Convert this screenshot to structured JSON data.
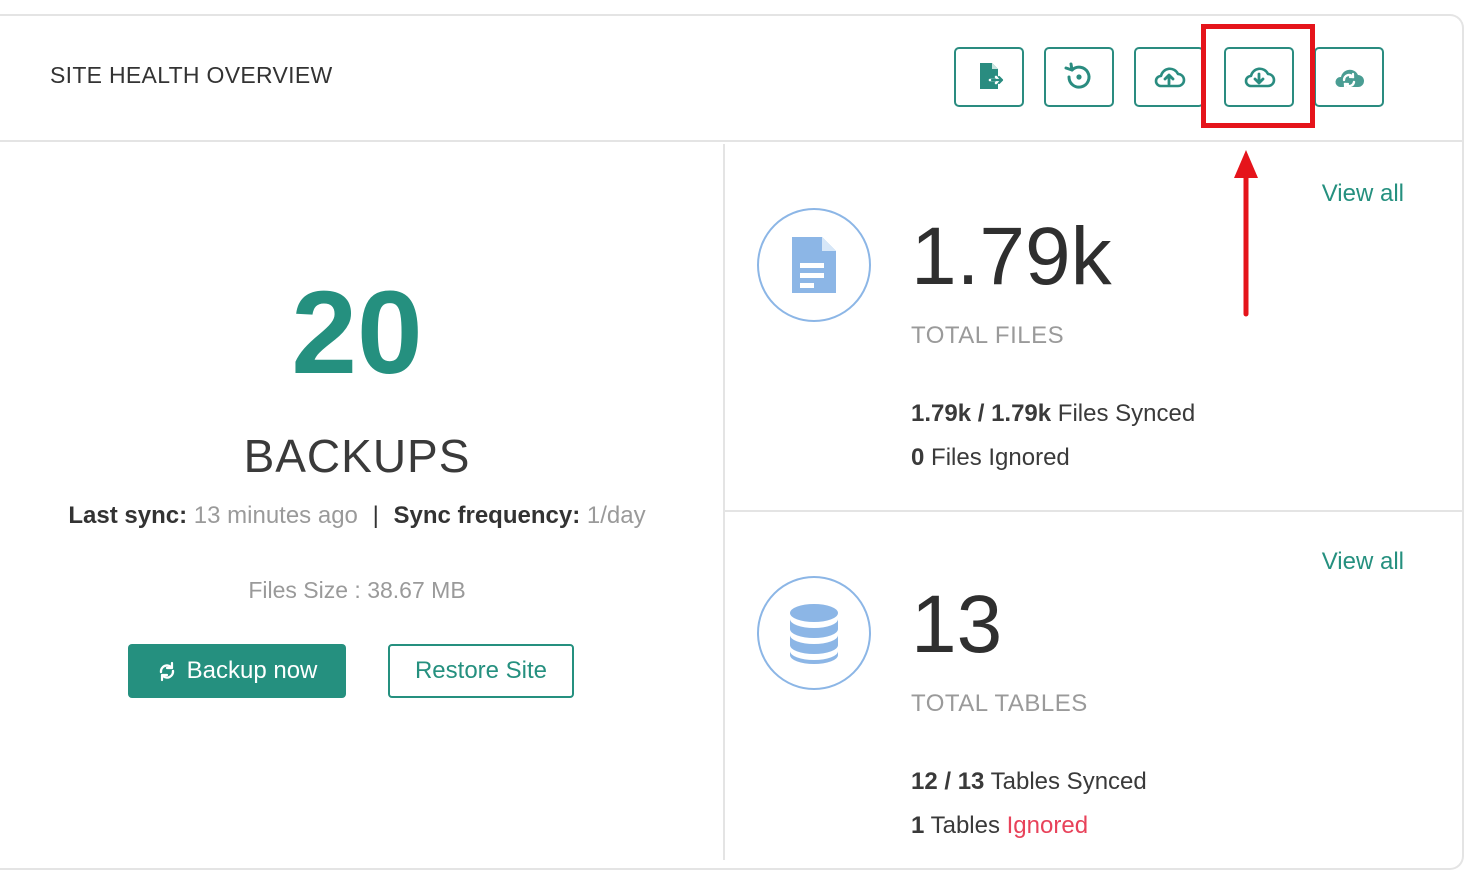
{
  "header": {
    "title": "SITE HEALTH OVERVIEW",
    "toolbar": [
      {
        "icon": "file-export-icon"
      },
      {
        "icon": "restore-history-icon"
      },
      {
        "icon": "cloud-upload-icon"
      },
      {
        "icon": "cloud-download-icon"
      },
      {
        "icon": "cloud-sync-icon"
      }
    ]
  },
  "backups": {
    "count": "20",
    "label": "BACKUPS",
    "last_sync_label": "Last sync:",
    "last_sync_value": "13 minutes ago",
    "separator": "|",
    "frequency_label": "Sync frequency:",
    "frequency_value": "1/day",
    "files_size": "Files Size : 38.67 MB",
    "backup_now_label": "Backup now",
    "restore_label": "Restore Site"
  },
  "files": {
    "view_all": "View all",
    "count": "1.79k",
    "label": "TOTAL FILES",
    "synced_value": "1.79k / 1.79k",
    "synced_text": "Files Synced",
    "ignored_value": "0",
    "ignored_text": "Files Ignored"
  },
  "tables": {
    "view_all": "View all",
    "count": "13",
    "label": "TOTAL TABLES",
    "synced_value": "12 / 13",
    "synced_text": "Tables Synced",
    "ignored_value": "1",
    "ignored_text_plain": "Tables",
    "ignored_text_highlight": "Ignored"
  },
  "colors": {
    "accent": "#25907f",
    "highlight": "#e5141b",
    "icon_blue": "#8cb6e6",
    "ignored_red": "#e8425a"
  }
}
